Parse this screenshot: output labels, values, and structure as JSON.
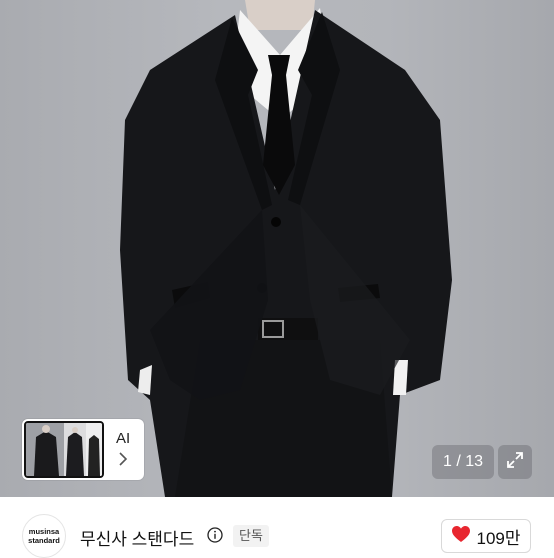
{
  "gallery": {
    "counter": "1 / 13",
    "ai_label": "AI"
  },
  "brand": {
    "logo_line1": "musinsa",
    "logo_line2": "standard",
    "name": "무신사 스탠다드",
    "badge": "단독"
  },
  "like": {
    "count": "109만",
    "color": "#e8262f"
  },
  "icons": [
    "expand-icon",
    "info-icon",
    "heart-icon",
    "chevron-right-icon"
  ]
}
